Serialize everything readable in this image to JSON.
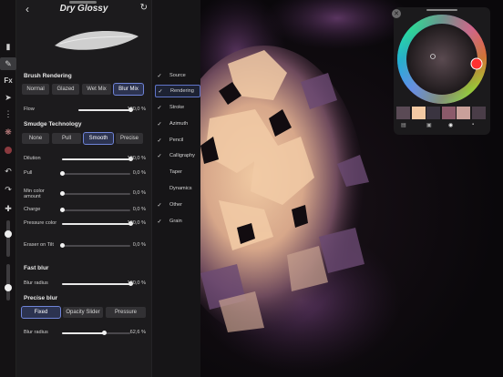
{
  "panel": {
    "title": "Dry Glossy",
    "back_icon": "chevron-left-icon",
    "reset_icon": "reset-icon"
  },
  "brush_rendering": {
    "heading": "Brush Rendering",
    "modes": [
      "Normal",
      "Glazed",
      "Wet Mix",
      "Blur Mix"
    ],
    "active_mode": "Blur Mix",
    "flow": {
      "label": "Flow",
      "value": "100,0 %",
      "level": 1.0
    }
  },
  "smudge": {
    "heading": "Smudge Technology",
    "modes": [
      "None",
      "Pull",
      "Smooth",
      "Precise"
    ],
    "active_mode": "Smooth",
    "sliders": [
      {
        "label": "Dilution",
        "value": "100,0 %",
        "level": 1.0
      },
      {
        "label": "Pull",
        "value": "0,0 %",
        "level": 0.0
      },
      {
        "label": "Min color amount",
        "value": "0,0 %",
        "level": 0.0
      },
      {
        "label": "Charge",
        "value": "0,0 %",
        "level": 0.0
      },
      {
        "label": "Pressure color",
        "value": "100,0 %",
        "level": 1.0
      },
      {
        "label": "Eraser on Tilt",
        "value": "0,0 %",
        "level": 0.0
      }
    ]
  },
  "fast_blur": {
    "heading": "Fast blur",
    "blur_radius": {
      "label": "Blur radius",
      "value": "100,0 %",
      "level": 1.0
    }
  },
  "precise_blur": {
    "heading": "Precise blur",
    "modes": [
      "Fixed",
      "Opacity Slider",
      "Pressure"
    ],
    "active_mode": "Fixed",
    "blur_radius": {
      "label": "Blur radius",
      "value": "62,6 %",
      "level": 0.626
    }
  },
  "categories": [
    {
      "label": "Source",
      "checked": true
    },
    {
      "label": "Rendering",
      "checked": true,
      "active": true
    },
    {
      "label": "Stroke",
      "checked": true
    },
    {
      "label": "Azimuth",
      "checked": true
    },
    {
      "label": "Pencil",
      "checked": true
    },
    {
      "label": "Calligraphy",
      "checked": true
    },
    {
      "label": "Taper",
      "checked": false
    },
    {
      "label": "Dynamics",
      "checked": false
    },
    {
      "label": "Other",
      "checked": true
    },
    {
      "label": "Grain",
      "checked": true
    }
  ],
  "toolbar": {
    "fx_label": "Fx",
    "icons": [
      "eraser-icon",
      "brush-icon",
      "fx-icon",
      "selection-icon",
      "more-icon",
      "color-picker-icon",
      "color-swatch-icon",
      "undo-icon",
      "redo-icon",
      "transform-icon"
    ],
    "current_color": "#8b3a3f",
    "size_level": 0.62,
    "opacity_level": 0.35
  },
  "color_picker": {
    "recent_colors": [
      "#5a4a55",
      "#f3c9a3",
      "#3a3440",
      "#8b5a6a",
      "#c9a09a",
      "#4a3d48"
    ],
    "hue_color": "#ff3030",
    "selected_color": "#3a2a2c"
  }
}
